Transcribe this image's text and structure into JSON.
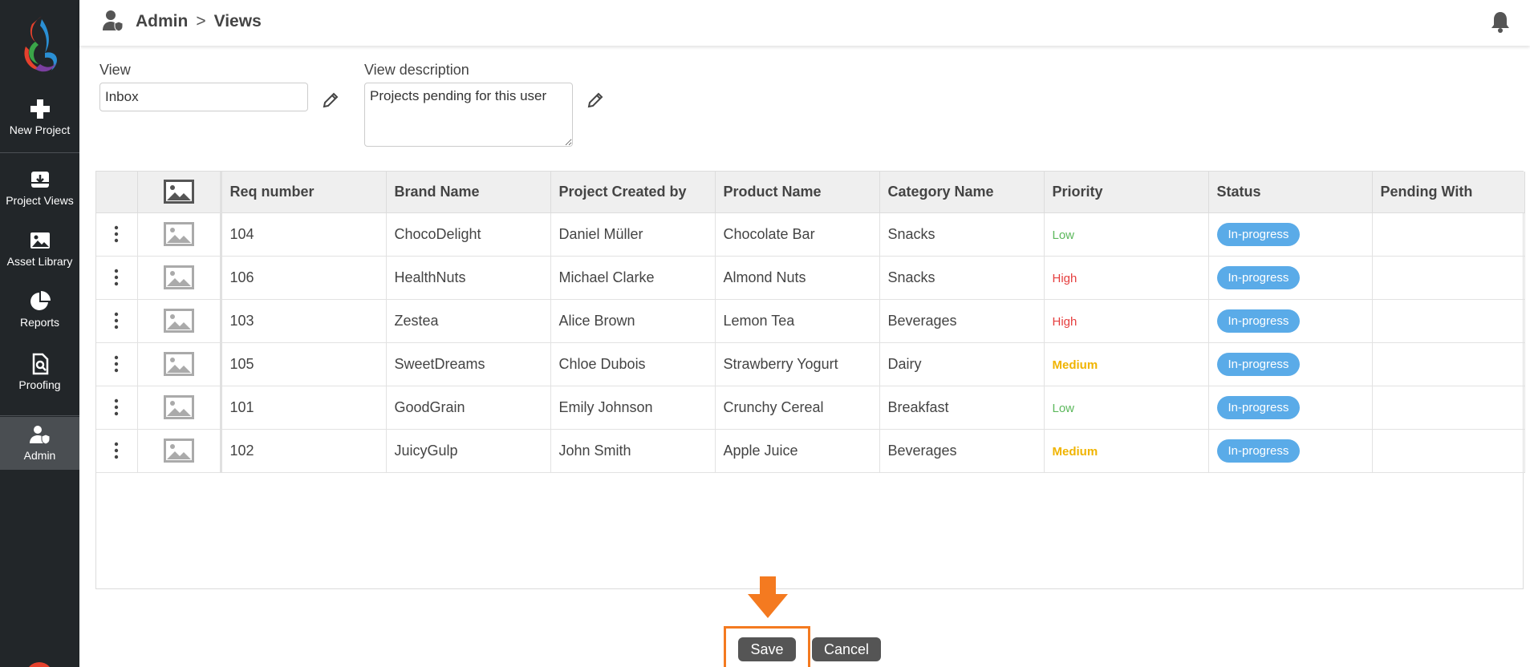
{
  "sidebar": {
    "items": [
      {
        "label": "New Project",
        "icon": "plus-icon"
      },
      {
        "label": "Project Views",
        "icon": "inbox-download-icon"
      },
      {
        "label": "Asset Library",
        "icon": "image-icon"
      },
      {
        "label": "Reports",
        "icon": "pie-chart-icon"
      },
      {
        "label": "Proofing",
        "icon": "document-search-icon"
      },
      {
        "label": "Admin",
        "icon": "user-shield-icon"
      }
    ]
  },
  "header": {
    "breadcrumb_root": "Admin",
    "breadcrumb_sep": ">",
    "breadcrumb_current": "Views"
  },
  "form": {
    "view_label": "View",
    "view_value": "Inbox",
    "desc_label": "View description",
    "desc_value": "Projects pending for this user"
  },
  "table": {
    "columns": [
      "Req number",
      "Brand Name",
      "Project Created by",
      "Product Name",
      "Category Name",
      "Priority",
      "Status",
      "Pending With"
    ],
    "rows": [
      {
        "req": "104",
        "brand": "ChocoDelight",
        "created_by": "Daniel Müller",
        "product": "Chocolate Bar",
        "category": "Snacks",
        "priority": "Low",
        "status": "In-progress",
        "pending": ""
      },
      {
        "req": "106",
        "brand": "HealthNuts",
        "created_by": "Michael Clarke",
        "product": "Almond Nuts",
        "category": "Snacks",
        "priority": "High",
        "status": "In-progress",
        "pending": ""
      },
      {
        "req": "103",
        "brand": "Zestea",
        "created_by": "Alice Brown",
        "product": "Lemon Tea",
        "category": "Beverages",
        "priority": "High",
        "status": "In-progress",
        "pending": ""
      },
      {
        "req": "105",
        "brand": "SweetDreams",
        "created_by": "Chloe Dubois",
        "product": "Strawberry Yogurt",
        "category": "Dairy",
        "priority": "Medium",
        "status": "In-progress",
        "pending": ""
      },
      {
        "req": "101",
        "brand": "GoodGrain",
        "created_by": "Emily Johnson",
        "product": "Crunchy Cereal",
        "category": "Breakfast",
        "priority": "Low",
        "status": "In-progress",
        "pending": ""
      },
      {
        "req": "102",
        "brand": "JuicyGulp",
        "created_by": "John Smith",
        "product": "Apple Juice",
        "category": "Beverages",
        "priority": "Medium",
        "status": "In-progress",
        "pending": ""
      }
    ]
  },
  "actions": {
    "save_label": "Save",
    "cancel_label": "Cancel"
  },
  "colors": {
    "sidebar_bg": "#222629",
    "status_badge": "#5aabe8",
    "priority_low": "#5cb85c",
    "priority_high": "#e53e3e",
    "priority_medium": "#f0b400",
    "highlight": "#f47a20"
  }
}
